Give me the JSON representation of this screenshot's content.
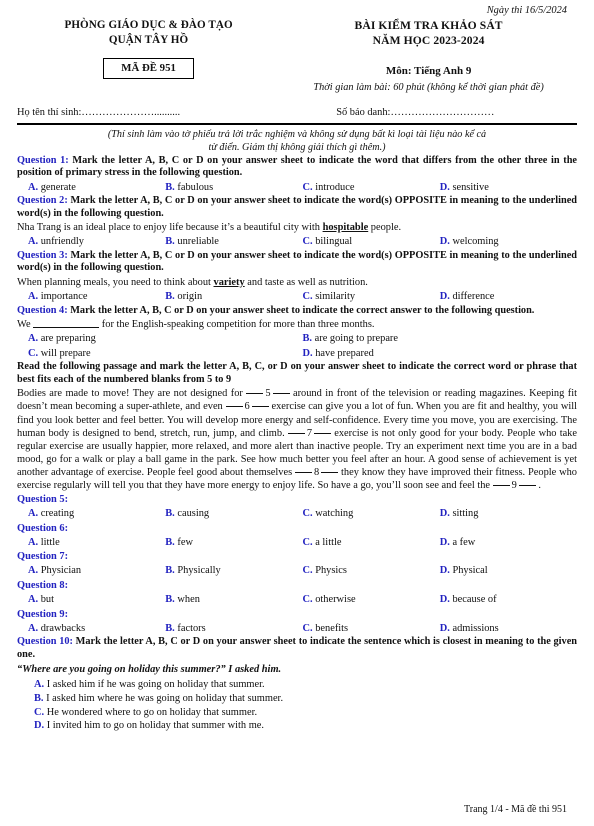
{
  "header": {
    "exam_date": "Ngày thi 16/5/2024",
    "department_line1": "PHÒNG GIÁO DỤC & ĐÀO TẠO",
    "department_line2": "QUẬN TÂY HỒ",
    "exam_title_line1": "BÀI KIỂM TRA KHẢO SÁT",
    "exam_title_line2": "NĂM HỌC 2023-2024",
    "code_box": "MÃ ĐỀ 951",
    "subject": "Môn: Tiếng Anh 9",
    "duration": "Thời gian làm bài: 60 phút (không kể thời gian phát đề)",
    "candidate_name_label": "Họ tên thí sinh:…………………..........",
    "candidate_number_label": "Số báo danh:…………………………",
    "note_line1": "(Thí sinh làm vào tờ phiếu trả lời trắc nghiệm và không sử dụng bất kì loại tài liệu nào kể cả",
    "note_line2": "từ điển. Giám thị không giải thích gì thêm.)"
  },
  "questions": {
    "q1": {
      "label": "Question 1:",
      "stem": " Mark the letter A, B, C or D on your answer sheet to indicate the word that differs from the other three in the position of primary stress in the following question.",
      "options": [
        {
          "letter": "A.",
          "text": " generate"
        },
        {
          "letter": "B.",
          "text": " fabulous"
        },
        {
          "letter": "C.",
          "text": " introduce"
        },
        {
          "letter": "D.",
          "text": " sensitive"
        }
      ]
    },
    "q2": {
      "label": "Question 2:",
      "stem": " Mark the letter A, B, C or D on your answer sheet to indicate the word(s) OPPOSITE in meaning to the underlined word(s) in the following question.",
      "sentence_pre": "Nha Trang is an ideal place to enjoy life because it’s a beautiful city with ",
      "sentence_underlined": "hospitable",
      "sentence_post": " people.",
      "options": [
        {
          "letter": "A.",
          "text": " unfriendly"
        },
        {
          "letter": "B.",
          "text": " unreliable"
        },
        {
          "letter": "C.",
          "text": " bilingual"
        },
        {
          "letter": "D.",
          "text": " welcoming"
        }
      ]
    },
    "q3": {
      "label": "Question 3:",
      "stem": " Mark the letter A, B, C or D on your answer sheet to indicate the word(s) OPPOSITE in meaning to the underlined word(s) in the following question.",
      "sentence_pre": "When planning meals, you need to think about ",
      "sentence_underlined": "variety",
      "sentence_post": " and taste as well as nutrition.",
      "options": [
        {
          "letter": "A.",
          "text": " importance"
        },
        {
          "letter": "B.",
          "text": " origin"
        },
        {
          "letter": "C.",
          "text": " similarity"
        },
        {
          "letter": "D.",
          "text": " difference"
        }
      ]
    },
    "q4": {
      "label": "Question 4:",
      "stem": " Mark the letter A, B, C or D on your answer sheet to indicate the correct answer to the following question.",
      "sentence_pre": "We ",
      "sentence_post": " for the English-speaking competition for more than three months.",
      "options": [
        {
          "letter": "A.",
          "text": " are preparing"
        },
        {
          "letter": "B.",
          "text": " are going to prepare"
        },
        {
          "letter": "C.",
          "text": " will prepare"
        },
        {
          "letter": "D.",
          "text": " have prepared"
        }
      ]
    },
    "q5": {
      "label": "Question 5:",
      "options": [
        {
          "letter": "A.",
          "text": " creating"
        },
        {
          "letter": "B.",
          "text": " causing"
        },
        {
          "letter": "C.",
          "text": " watching"
        },
        {
          "letter": "D.",
          "text": " sitting"
        }
      ]
    },
    "q6": {
      "label": "Question 6:",
      "options": [
        {
          "letter": "A.",
          "text": " little"
        },
        {
          "letter": "B.",
          "text": " few"
        },
        {
          "letter": "C.",
          "text": " a little"
        },
        {
          "letter": "D.",
          "text": " a few"
        }
      ]
    },
    "q7": {
      "label": "Question 7:",
      "options": [
        {
          "letter": "A.",
          "text": " Physician"
        },
        {
          "letter": "B.",
          "text": " Physically"
        },
        {
          "letter": "C.",
          "text": " Physics"
        },
        {
          "letter": "D.",
          "text": " Physical"
        }
      ]
    },
    "q8": {
      "label": "Question 8:",
      "options": [
        {
          "letter": "A.",
          "text": " but"
        },
        {
          "letter": "B.",
          "text": " when"
        },
        {
          "letter": "C.",
          "text": " otherwise"
        },
        {
          "letter": "D.",
          "text": " because of"
        }
      ]
    },
    "q9": {
      "label": "Question 9:",
      "options": [
        {
          "letter": "A.",
          "text": " drawbacks"
        },
        {
          "letter": "B.",
          "text": " factors"
        },
        {
          "letter": "C.",
          "text": " benefits"
        },
        {
          "letter": "D.",
          "text": " admissions"
        }
      ]
    },
    "q10": {
      "label": "Question 10:",
      "stem": " Mark the letter A, B, C or D on your answer sheet to indicate the sentence which is closest in meaning to the given one.",
      "quote": "“Where are you going on holiday this summer?” I asked him.",
      "options": [
        {
          "letter": "A.",
          "text": " I asked him if he was going on holiday that summer."
        },
        {
          "letter": "B.",
          "text": " I asked him where he was going on holiday that summer."
        },
        {
          "letter": "C.",
          "text": " He wondered where to go on holiday that summer."
        },
        {
          "letter": "D.",
          "text": " I invited him to go on holiday that summer with me."
        }
      ]
    }
  },
  "reading": {
    "instruction": "Read the following passage and mark the letter A, B, C, or D on your answer sheet to indicate the correct word or phrase that best fits each of the numbered blanks from 5 to 9",
    "text_part1": "Bodies are made to move! They are not designed for ",
    "gap5": "5",
    "text_part2": " around in front of the television or reading magazines. Keeping fit doesn’t mean becoming a super-athlete, and even ",
    "gap6": "6",
    "text_part3": " exercise can give you a lot of fun. When you are fit and healthy, you will find you look better and feel better. You will develop more energy and self-confidence. Every time you move, you are exercising. The human body is designed to bend, stretch, run, jump, and climb. ",
    "gap7": "7",
    "text_part4": " exercise is not only good for your body. People who take regular exercise are usually happier, more relaxed, and more alert than inactive people. Try an experiment next time you are in a bad mood, go for a walk or play a ball game in the park. See how much better you feel after an hour. A good sense of achievement is yet another advantage of exercise. People feel good about themselves ",
    "gap8": "8",
    "text_part5": " they know they have improved their fitness. People who exercise regularly will tell you that they have more energy to enjoy life. So have a go, you’ll soon see and feel the ",
    "gap9": "9",
    "text_part6": " ."
  },
  "footer": {
    "page_label": "Trang 1/4 - Mã đề thi 951"
  },
  "colors": {
    "question_blue": "#2222c0",
    "text_black": "#111111"
  }
}
